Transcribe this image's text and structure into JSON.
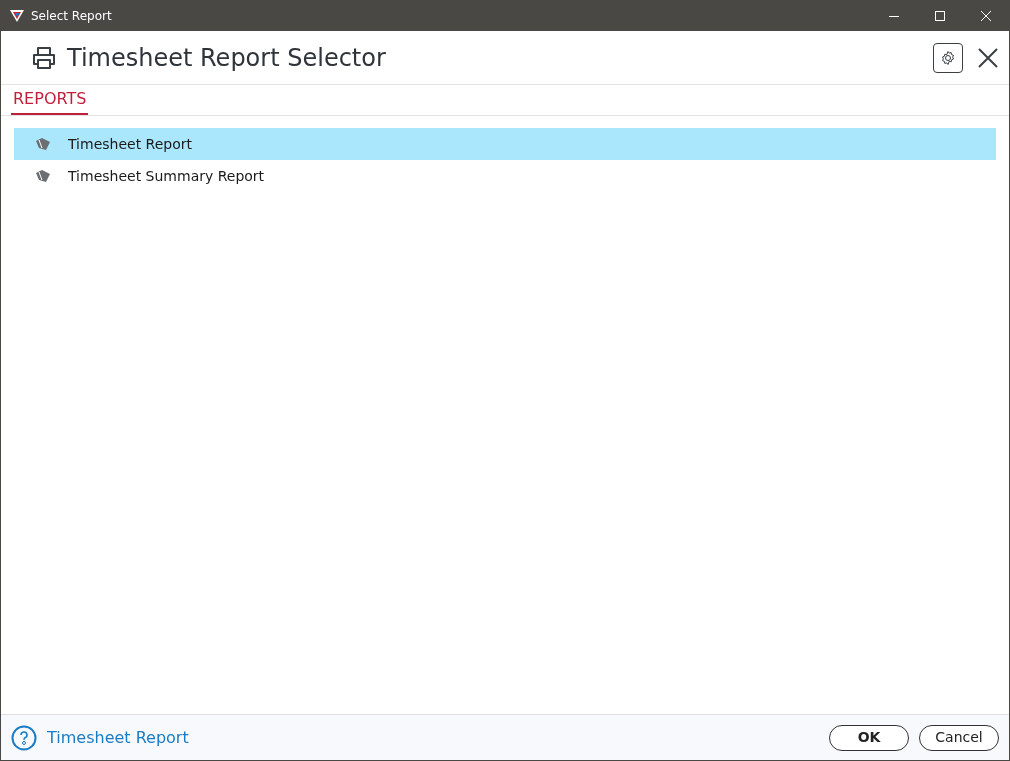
{
  "window": {
    "title": "Select Report"
  },
  "header": {
    "title": "Timesheet Report Selector"
  },
  "tabs": [
    {
      "label": "REPORTS",
      "selected": true
    }
  ],
  "reports": [
    {
      "label": "Timesheet Report",
      "selected": true
    },
    {
      "label": "Timesheet Summary Report",
      "selected": false
    }
  ],
  "footer": {
    "help_link": "Timesheet Report",
    "buttons": [
      {
        "label": "OK",
        "kind": "primary"
      },
      {
        "label": "Cancel",
        "kind": "secondary"
      }
    ]
  }
}
